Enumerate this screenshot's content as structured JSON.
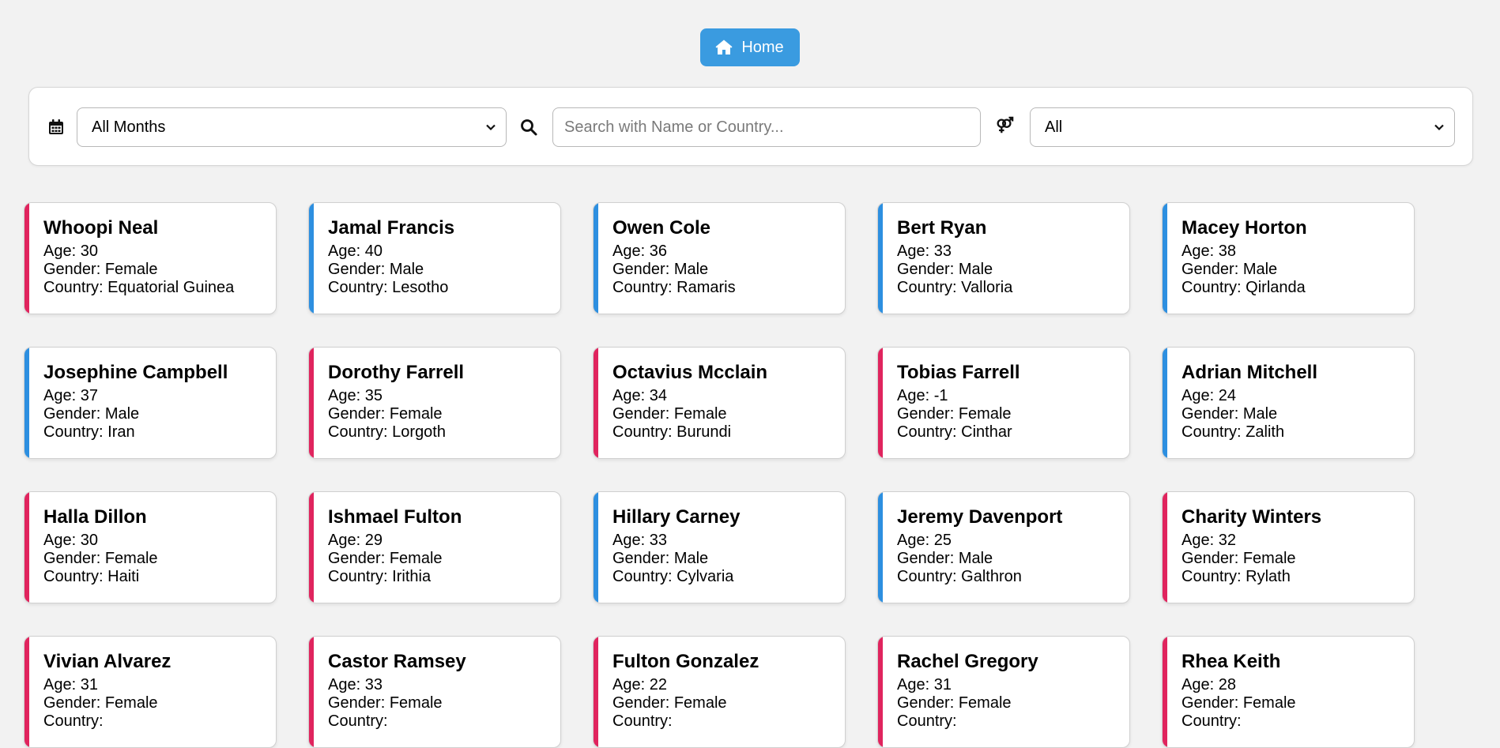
{
  "home_button": {
    "label": "Home"
  },
  "filters": {
    "month_select": {
      "value": "All Months"
    },
    "search": {
      "placeholder": "Search with Name or Country..."
    },
    "gender_select": {
      "value": "All"
    }
  },
  "labels": {
    "age": "Age: ",
    "gender": "Gender: ",
    "country": "Country: "
  },
  "colors": {
    "accent_pink": "#e0245e",
    "accent_blue": "#2d8fe0",
    "home_button": "#3a9be0"
  },
  "people": [
    {
      "name": "Whoopi Neal",
      "age": "30",
      "gender": "Female",
      "country": "Equatorial Guinea",
      "accent": "#e0245e"
    },
    {
      "name": "Jamal Francis",
      "age": "40",
      "gender": "Male",
      "country": "Lesotho",
      "accent": "#2d8fe0"
    },
    {
      "name": "Owen Cole",
      "age": "36",
      "gender": "Male",
      "country": "Ramaris",
      "accent": "#2d8fe0"
    },
    {
      "name": "Bert Ryan",
      "age": "33",
      "gender": "Male",
      "country": "Valloria",
      "accent": "#2d8fe0"
    },
    {
      "name": "Macey Horton",
      "age": "38",
      "gender": "Male",
      "country": "Qirlanda",
      "accent": "#2d8fe0"
    },
    {
      "name": "Josephine Campbell",
      "age": "37",
      "gender": "Male",
      "country": "Iran",
      "accent": "#2d8fe0"
    },
    {
      "name": "Dorothy Farrell",
      "age": "35",
      "gender": "Female",
      "country": "Lorgoth",
      "accent": "#e0245e"
    },
    {
      "name": "Octavius Mcclain",
      "age": "34",
      "gender": "Female",
      "country": "Burundi",
      "accent": "#e0245e"
    },
    {
      "name": "Tobias Farrell",
      "age": "-1",
      "gender": "Female",
      "country": "Cinthar",
      "accent": "#e0245e"
    },
    {
      "name": "Adrian Mitchell",
      "age": "24",
      "gender": "Male",
      "country": "Zalith",
      "accent": "#2d8fe0"
    },
    {
      "name": "Halla Dillon",
      "age": "30",
      "gender": "Female",
      "country": "Haiti",
      "accent": "#e0245e"
    },
    {
      "name": "Ishmael Fulton",
      "age": "29",
      "gender": "Female",
      "country": "Irithia",
      "accent": "#e0245e"
    },
    {
      "name": "Hillary Carney",
      "age": "33",
      "gender": "Male",
      "country": "Cylvaria",
      "accent": "#2d8fe0"
    },
    {
      "name": "Jeremy Davenport",
      "age": "25",
      "gender": "Male",
      "country": "Galthron",
      "accent": "#2d8fe0"
    },
    {
      "name": "Charity Winters",
      "age": "32",
      "gender": "Female",
      "country": "Rylath",
      "accent": "#e0245e"
    },
    {
      "name": "Vivian Alvarez",
      "age": "31",
      "gender": "Female",
      "country": "",
      "accent": "#e0245e"
    },
    {
      "name": "Castor Ramsey",
      "age": "33",
      "gender": "Female",
      "country": "",
      "accent": "#e0245e"
    },
    {
      "name": "Fulton Gonzalez",
      "age": "22",
      "gender": "Female",
      "country": "",
      "accent": "#e0245e"
    },
    {
      "name": "Rachel Gregory",
      "age": "31",
      "gender": "Female",
      "country": "",
      "accent": "#e0245e"
    },
    {
      "name": "Rhea Keith",
      "age": "28",
      "gender": "Female",
      "country": "",
      "accent": "#e0245e"
    }
  ]
}
